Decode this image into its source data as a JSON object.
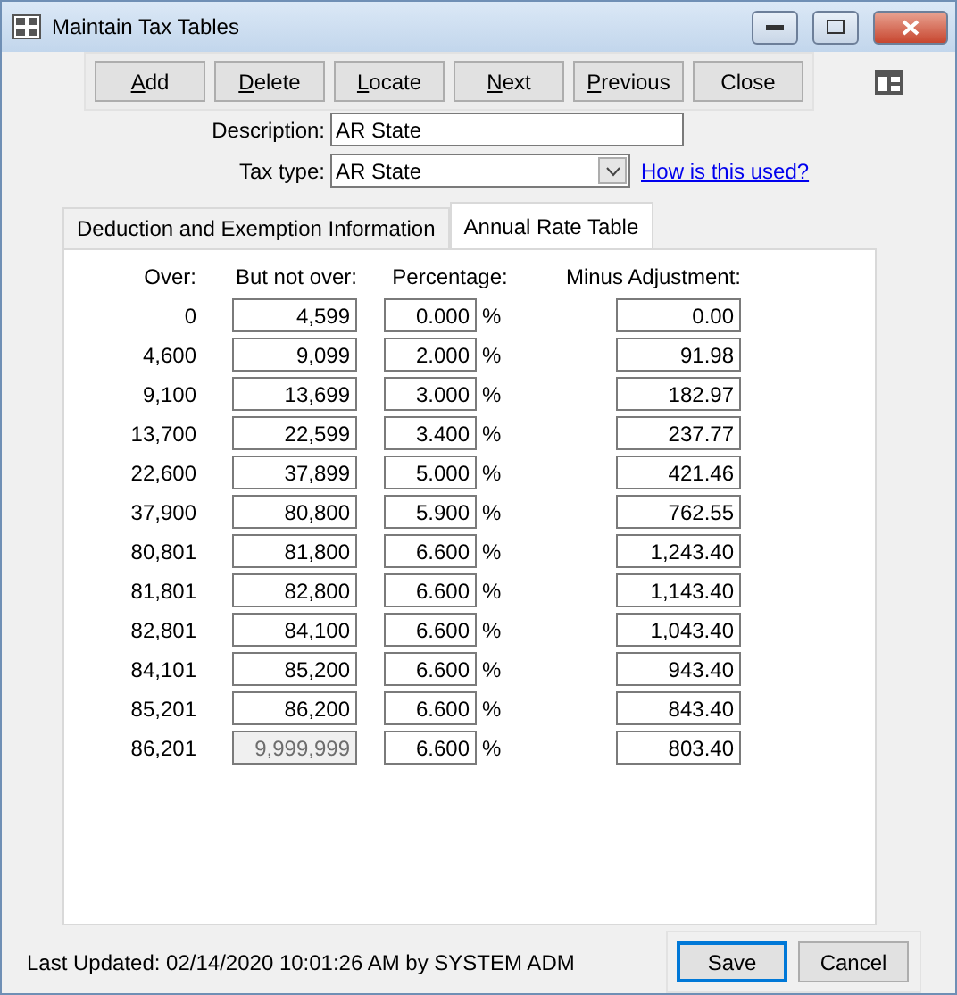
{
  "window": {
    "title": "Maintain Tax Tables"
  },
  "toolbar": [
    {
      "label": "Add",
      "mnemonic": true
    },
    {
      "label": "Delete",
      "mnemonic": true
    },
    {
      "label": "Locate",
      "mnemonic": true
    },
    {
      "label": "Next",
      "mnemonic": true
    },
    {
      "label": "Previous",
      "mnemonic": true
    },
    {
      "label": "Close",
      "mnemonic": false
    }
  ],
  "description": {
    "label": "Description:",
    "value": "AR State"
  },
  "tax_type": {
    "label": "Tax type:",
    "value": "AR State",
    "link": "How is this used?"
  },
  "tabs": [
    {
      "label": "Deduction and Exemption Information",
      "selected": false
    },
    {
      "label": "Annual Rate Table",
      "selected": true
    }
  ],
  "columns": [
    "Over:",
    "But not over:",
    "Percentage:",
    "Minus Adjustment:"
  ],
  "rows": [
    {
      "over": "0",
      "but_not_over": "4,599",
      "disabled": false,
      "percentage": "0.000",
      "unit": "%",
      "minus": "0.00"
    },
    {
      "over": "4,600",
      "but_not_over": "9,099",
      "disabled": false,
      "percentage": "2.000",
      "unit": "%",
      "minus": "91.98"
    },
    {
      "over": "9,100",
      "but_not_over": "13,699",
      "disabled": false,
      "percentage": "3.000",
      "unit": "%",
      "minus": "182.97"
    },
    {
      "over": "13,700",
      "but_not_over": "22,599",
      "disabled": false,
      "percentage": "3.400",
      "unit": "%",
      "minus": "237.77"
    },
    {
      "over": "22,600",
      "but_not_over": "37,899",
      "disabled": false,
      "percentage": "5.000",
      "unit": "%",
      "minus": "421.46"
    },
    {
      "over": "37,900",
      "but_not_over": "80,800",
      "disabled": false,
      "percentage": "5.900",
      "unit": "%",
      "minus": "762.55"
    },
    {
      "over": "80,801",
      "but_not_over": "81,800",
      "disabled": false,
      "percentage": "6.600",
      "unit": "%",
      "minus": "1,243.40"
    },
    {
      "over": "81,801",
      "but_not_over": "82,800",
      "disabled": false,
      "percentage": "6.600",
      "unit": "%",
      "minus": "1,143.40"
    },
    {
      "over": "82,801",
      "but_not_over": "84,100",
      "disabled": false,
      "percentage": "6.600",
      "unit": "%",
      "minus": "1,043.40"
    },
    {
      "over": "84,101",
      "but_not_over": "85,200",
      "disabled": false,
      "percentage": "6.600",
      "unit": "%",
      "minus": "943.40"
    },
    {
      "over": "85,201",
      "but_not_over": "86,200",
      "disabled": false,
      "percentage": "6.600",
      "unit": "%",
      "minus": "843.40"
    },
    {
      "over": "86,201",
      "but_not_over": "9,999,999",
      "disabled": true,
      "percentage": "6.600",
      "unit": "%",
      "minus": "803.40"
    }
  ],
  "status": "Last Updated: 02/14/2020 10:01:26 AM by SYSTEM ADM",
  "buttons": [
    {
      "label": "Save",
      "focused": true
    },
    {
      "label": "Cancel",
      "focused": false
    }
  ]
}
